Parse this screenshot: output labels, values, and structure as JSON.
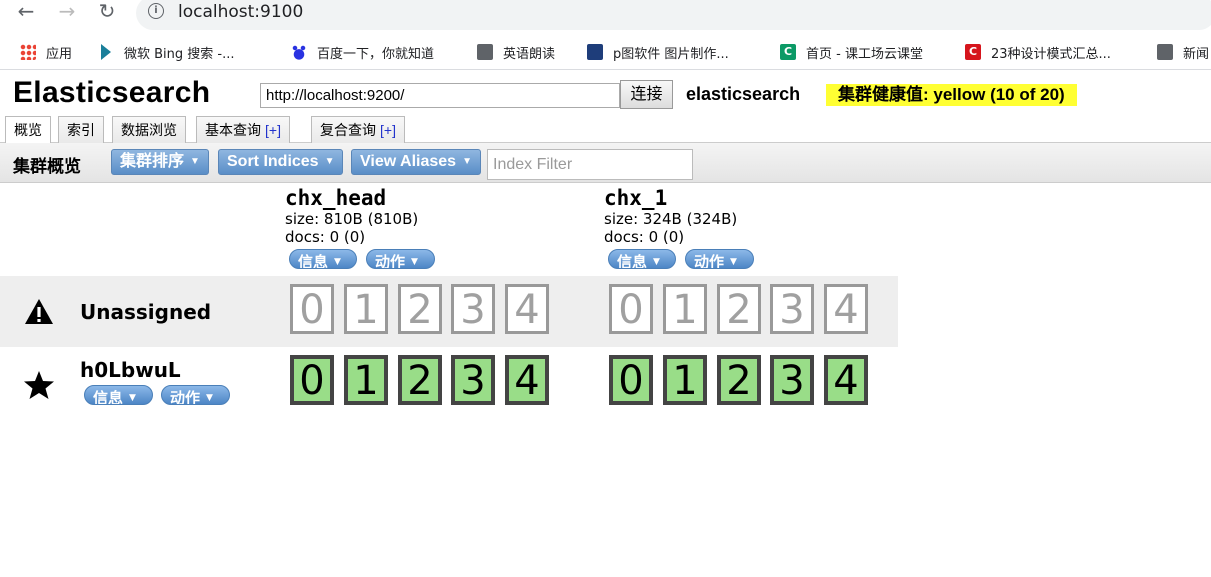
{
  "browser": {
    "url": "localhost:9100",
    "bookmarks": [
      {
        "icon": "apps-icon",
        "label": "应用"
      },
      {
        "icon": "bing-icon",
        "label": "微软 Bing 搜索 -..."
      },
      {
        "icon": "baidu-icon",
        "label": "百度一下，你就知道"
      },
      {
        "icon": "globe-icon",
        "label": "英语朗读"
      },
      {
        "icon": "p-icon",
        "label": "p图软件 图片制作..."
      },
      {
        "icon": "c-icon",
        "label": "首页 - 课工场云课堂"
      },
      {
        "icon": "c-icon",
        "label": "23种设计模式汇总..."
      },
      {
        "icon": "globe-icon",
        "label": "新闻"
      }
    ]
  },
  "app": {
    "title": "Elasticsearch",
    "connection_url": "http://localhost:9200/",
    "connect_label": "连接",
    "cluster_name": "elasticsearch",
    "health_text": "集群健康值: yellow (10 of 20)",
    "health_color": "#ffff33"
  },
  "tabs": [
    {
      "label": "概览",
      "plus": ""
    },
    {
      "label": "索引",
      "plus": ""
    },
    {
      "label": "数据浏览",
      "plus": ""
    },
    {
      "label": "基本查询",
      "plus": "[+]"
    },
    {
      "label": "复合查询",
      "plus": "[+]"
    }
  ],
  "toolbar": {
    "title": "集群概览",
    "sort_cluster": "集群排序",
    "sort_indices": "Sort Indices",
    "view_aliases": "View Aliases",
    "filter_placeholder": "Index Filter"
  },
  "pills": {
    "info": "信息",
    "action": "动作"
  },
  "indices": [
    {
      "name": "chx_head",
      "size": "size: 810B (810B)",
      "docs": "docs: 0 (0)"
    },
    {
      "name": "chx_1",
      "size": "size: 324B (324B)",
      "docs": "docs: 0 (0)"
    }
  ],
  "rows": {
    "unassigned": {
      "label": "Unassigned",
      "icon": "warning-icon",
      "shards": [
        "0",
        "1",
        "2",
        "3",
        "4"
      ]
    },
    "node": {
      "label": "h0LbwuL",
      "icon": "star-icon",
      "shards": [
        "0",
        "1",
        "2",
        "3",
        "4"
      ],
      "shard_color": "#99dd88"
    }
  }
}
